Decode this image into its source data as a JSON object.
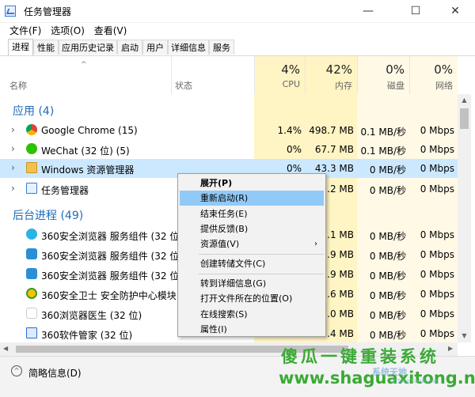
{
  "window": {
    "title": "任务管理器",
    "minimize": "—",
    "maximize": "☐",
    "close": "✕"
  },
  "menu": [
    "文件(F)",
    "选项(O)",
    "查看(V)"
  ],
  "tabs": [
    "进程",
    "性能",
    "应用历史记录",
    "启动",
    "用户",
    "详细信息",
    "服务"
  ],
  "header": {
    "name_label": "名称",
    "status_label": "状态",
    "sort_arrow": "^",
    "columns": [
      {
        "pct": "4%",
        "label": "CPU"
      },
      {
        "pct": "42%",
        "label": "内存"
      },
      {
        "pct": "0%",
        "label": "磁盘"
      },
      {
        "pct": "0%",
        "label": "网络"
      }
    ]
  },
  "apps_section": "应用 (4)",
  "apps": [
    {
      "name": "Google Chrome (15)",
      "cpu": "1.4%",
      "mem": "498.7 MB",
      "disk": "0.1 MB/秒",
      "net": "0 Mbps",
      "icon": "chrome-icon"
    },
    {
      "name": "WeChat (32 位) (5)",
      "cpu": "0%",
      "mem": "67.7 MB",
      "disk": "0.1 MB/秒",
      "net": "0 Mbps",
      "icon": "wechat-icon"
    },
    {
      "name": "Windows 资源管理器",
      "cpu": "0%",
      "mem": "43.3 MB",
      "disk": "0 MB/秒",
      "net": "0 Mbps",
      "icon": "explorer-icon"
    },
    {
      "name": "任务管理器",
      "cpu": "",
      "mem": ".2 MB",
      "disk": "0 MB/秒",
      "net": "0 Mbps",
      "icon": "task-manager-icon"
    }
  ],
  "bg_section": "后台进程 (49)",
  "background": [
    {
      "name": "360安全浏览器 服务组件 (32 位)",
      "mem": ".1 MB",
      "disk": "0 MB/秒",
      "net": "0 Mbps",
      "icon": "360-browser-service-icon"
    },
    {
      "name": "360安全浏览器 服务组件 (32 位)",
      "mem": ".9 MB",
      "disk": "0 MB/秒",
      "net": "0 Mbps",
      "icon": "360-browser-service-icon"
    },
    {
      "name": "360安全浏览器 服务组件 (32 位)",
      "mem": ".9 MB",
      "disk": "0 MB/秒",
      "net": "0 Mbps",
      "icon": "360-browser-service-icon"
    },
    {
      "name": "360安全卫士 安全防护中心模块...",
      "mem": ".6 MB",
      "disk": "0 MB/秒",
      "net": "0 Mbps",
      "icon": "360-safeguard-icon"
    },
    {
      "name": "360浏览器医生 (32 位)",
      "mem": ".0 MB",
      "disk": "0 MB/秒",
      "net": "0 Mbps",
      "icon": "360-browser-doctor-icon"
    },
    {
      "name": "360软件管家 (32 位)",
      "mem": ".4 MB",
      "disk": "0 MB/秒",
      "net": "0 Mbps",
      "icon": "360-software-manager-icon"
    }
  ],
  "context_menu": {
    "items": [
      {
        "label": "展开(P)",
        "bold": true
      },
      {
        "label": "重新启动(R)",
        "highlighted": true
      },
      {
        "label": "结束任务(E)"
      },
      {
        "label": "提供反馈(B)"
      },
      {
        "label": "资源值(V)",
        "submenu": true
      },
      {
        "label": "创建转储文件(C)"
      },
      {
        "label": "转到详细信息(G)"
      },
      {
        "label": "打开文件所在的位置(O)"
      },
      {
        "label": "在线搜索(S)"
      },
      {
        "label": "属性(I)"
      }
    ],
    "submenu_arrow": "›"
  },
  "footer": {
    "fewer_details": "简略信息(D)",
    "fewer_icon": "^"
  },
  "watermark": {
    "line1": "傻瓜一键重装系统",
    "line2": "www.shaguaxitong.net",
    "logo": "系统天地",
    "logo_sub": "XiTongTianDi.net"
  },
  "colors": {
    "accent": "#1e6bb8",
    "selected_row": "#cce8ff",
    "yellow_col": "#fff4c4",
    "light_yellow_col": "#fff9e6",
    "menu_highlight": "#91c9f7",
    "watermark_green": "#3aaa35"
  }
}
